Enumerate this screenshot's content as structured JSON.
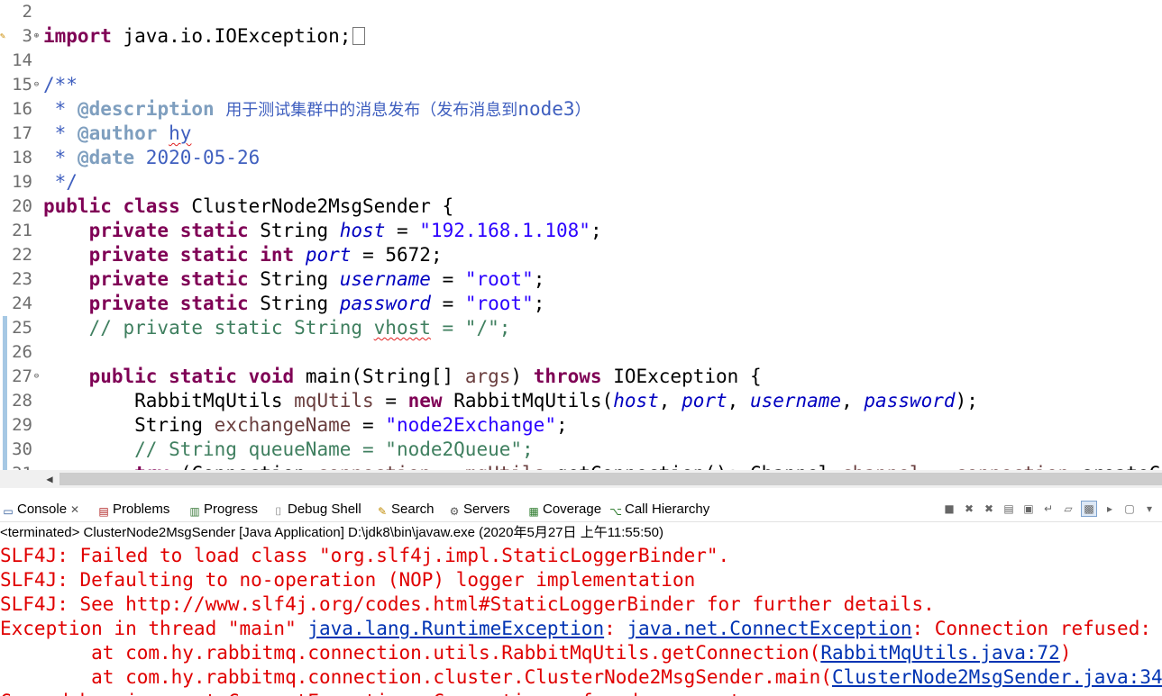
{
  "editor": {
    "lines": [
      {
        "num": "2",
        "html": ""
      },
      {
        "num": "3",
        "fold": "+",
        "warn": true,
        "html": "<span class=\"kw\">import</span> java.io.IOException;<span class=\"collapsed-box\"></span>"
      },
      {
        "num": "14",
        "html": ""
      },
      {
        "num": "15",
        "fold": "-",
        "html": "<span class=\"jd\">/**</span>"
      },
      {
        "num": "16",
        "html": "<span class=\"jd\"> * </span><span class=\"jdt\">@description</span><span class=\"jd\"> <span class=\"cjk\">用于测试集群中的消息发布（发布消息到</span>node3<span class=\"cjk\">）</span></span>"
      },
      {
        "num": "17",
        "html": "<span class=\"jd\"> * </span><span class=\"jdt\">@author</span><span class=\"jd\"> <span class=\"sq\">hy</span></span>"
      },
      {
        "num": "18",
        "html": "<span class=\"jd\"> * </span><span class=\"jdt\">@date</span><span class=\"jd\"> 2020-05-26</span>"
      },
      {
        "num": "19",
        "html": "<span class=\"jd\"> */</span>"
      },
      {
        "num": "20",
        "html": "<span class=\"kw\">public</span> <span class=\"kw\">class</span> ClusterNode2MsgSender {"
      },
      {
        "num": "21",
        "html": "    <span class=\"kw\">private</span> <span class=\"kw\">static</span> String <span class=\"fld\">host</span> = <span class=\"str\">\"192.168.1.108\"</span>;"
      },
      {
        "num": "22",
        "html": "    <span class=\"kw\">private</span> <span class=\"kw\">static</span> <span class=\"kw\">int</span> <span class=\"fld\">port</span> = 5672;"
      },
      {
        "num": "23",
        "html": "    <span class=\"kw\">private</span> <span class=\"kw\">static</span> String <span class=\"fld\">username</span> = <span class=\"str\">\"root\"</span>;"
      },
      {
        "num": "24",
        "html": "    <span class=\"kw\">private</span> <span class=\"kw\">static</span> String <span class=\"fld\">password</span> = <span class=\"str\">\"root\"</span>;"
      },
      {
        "num": "25",
        "changed": true,
        "html": "    <span class=\"cm\">// private static String <span class=\"sq\">vhost</span> = \"/\";</span>"
      },
      {
        "num": "26",
        "changed": true,
        "html": ""
      },
      {
        "num": "27",
        "fold": "-",
        "changed": true,
        "html": "    <span class=\"kw\">public</span> <span class=\"kw\">static</span> <span class=\"kw\">void</span> main(String[] <span class=\"lv\">args</span>) <span class=\"kw\">throws</span> IOException {"
      },
      {
        "num": "28",
        "changed": true,
        "html": "        RabbitMqUtils <span class=\"lv\">mqUtils</span> = <span class=\"kw\">new</span> RabbitMqUtils(<span class=\"fld\">host</span>, <span class=\"fld\">port</span>, <span class=\"fld\">username</span>, <span class=\"fld\">password</span>);"
      },
      {
        "num": "29",
        "changed": true,
        "html": "        String <span class=\"lv\">exchangeName</span> = <span class=\"str\">\"node2Exchange\"</span>;"
      },
      {
        "num": "30",
        "changed": true,
        "html": "        <span class=\"cm\">// String queueName = \"node2Queue\";</span>"
      },
      {
        "num": "31",
        "changed": true,
        "html": "        <span class=\"kw\">try</span> (Connection <span class=\"lv\">connection</span> = <span class=\"lv\">mqUtils</span>.getConnection(); Channel <span class=\"lv\">channel</span> = <span class=\"lv\">connection</span>.createChannel()) {"
      }
    ]
  },
  "console_tabs": [
    {
      "icon": "console-icon",
      "glyph": "▭",
      "color": "#2b5797",
      "label": "Console",
      "close": "✕"
    },
    {
      "icon": "problems-icon",
      "glyph": "▤",
      "color": "#b02020",
      "label": "Problems"
    },
    {
      "icon": "progress-icon",
      "glyph": "▥",
      "color": "#3a7a3a",
      "label": "Progress"
    },
    {
      "icon": "debug-shell-icon",
      "glyph": "⌷",
      "color": "#555555",
      "label": "Debug Shell"
    },
    {
      "icon": "search-icon",
      "glyph": "✎",
      "color": "#c08a00",
      "label": "Search"
    },
    {
      "icon": "servers-icon",
      "glyph": "⚙",
      "color": "#555555",
      "label": "Servers"
    },
    {
      "icon": "coverage-icon",
      "glyph": "▦",
      "color": "#2b7a2b",
      "label": "Coverage"
    },
    {
      "icon": "call-hierarchy-icon",
      "glyph": "⌥",
      "color": "#2b7a2b",
      "label": "Call Hierarchy"
    }
  ],
  "toolbar_buttons": [
    {
      "name": "terminate-icon",
      "glyph": "■"
    },
    {
      "name": "remove-launch-icon",
      "glyph": "✖"
    },
    {
      "name": "remove-all-terminated-icon",
      "glyph": "✖"
    },
    {
      "name": "clear-console-icon",
      "glyph": "▤"
    },
    {
      "name": "scroll-lock-icon",
      "glyph": "▣"
    },
    {
      "name": "word-wrap-icon",
      "glyph": "↵"
    },
    {
      "name": "show-on-output-icon",
      "glyph": "▱"
    },
    {
      "name": "pin-console-icon",
      "glyph": "▩",
      "active": true
    },
    {
      "name": "display-selected-console-icon",
      "glyph": "▸"
    },
    {
      "name": "open-console-icon",
      "glyph": "▢"
    },
    {
      "name": "view-menu-icon",
      "glyph": "▾"
    }
  ],
  "status": "<terminated> ClusterNode2MsgSender [Java Application] D:\\jdk8\\bin\\javaw.exe (2020年5月27日 上午11:55:50)",
  "console": [
    {
      "segments": [
        {
          "t": "SLF4J: Failed to load class \"org.slf4j.impl.StaticLoggerBinder\"."
        }
      ]
    },
    {
      "segments": [
        {
          "t": "SLF4J: Defaulting to no-operation (NOP) logger implementation"
        }
      ]
    },
    {
      "segments": [
        {
          "t": "SLF4J: See http://www.slf4j.org/codes.html#StaticLoggerBinder for further details."
        }
      ]
    },
    {
      "segments": [
        {
          "t": "Exception in thread \"main\" "
        },
        {
          "t": "java.lang.RuntimeException",
          "link": true
        },
        {
          "t": ": "
        },
        {
          "t": "java.net.ConnectException",
          "link": true
        },
        {
          "t": ": Connection refused: connect"
        }
      ]
    },
    {
      "segments": [
        {
          "t": "\tat com.hy.rabbitmq.connection.utils.RabbitMqUtils.getConnection("
        },
        {
          "t": "RabbitMqUtils.java:72",
          "link": true
        },
        {
          "t": ")"
        }
      ]
    },
    {
      "segments": [
        {
          "t": "\tat com.hy.rabbitmq.connection.cluster.ClusterNode2MsgSender.main("
        },
        {
          "t": "ClusterNode2MsgSender.java:34",
          "link": true
        },
        {
          "t": ")"
        }
      ]
    },
    {
      "segments": [
        {
          "t": "Caused by: java.net.ConnectException: Connection refused: connect"
        }
      ]
    }
  ]
}
